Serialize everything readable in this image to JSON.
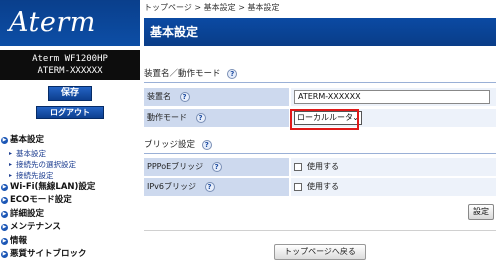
{
  "sidebar": {
    "logo": "Aterm",
    "model_line1": "Aterm WF1200HP",
    "model_line2": "ATERM-XXXXXX",
    "save_label": "保存",
    "logout_label": "ログアウト",
    "menu": [
      {
        "label": "基本設定",
        "bullet": "▶"
      },
      {
        "label": "基本設定",
        "sub": true
      },
      {
        "label": "接続先の選択設定",
        "sub": true
      },
      {
        "label": "接続先設定",
        "sub": true
      },
      {
        "label": "Wi-Fi(無線LAN)設定",
        "bullet": "▶"
      },
      {
        "label": "ECOモード設定",
        "bullet": "▶"
      },
      {
        "label": "詳細設定",
        "bullet": "▶"
      },
      {
        "label": "メンテナンス",
        "bullet": "▶"
      },
      {
        "label": "情報",
        "bullet": "▶"
      },
      {
        "label": "悪質サイトブロック",
        "bullet": "▶"
      }
    ]
  },
  "breadcrumb": {
    "top": "トップページ",
    "sep1": ">",
    "parent": "基本設定",
    "sep2": ">",
    "current": "基本設定"
  },
  "page_title": "基本設定",
  "sections": {
    "device": {
      "heading": "装置名／動作モード",
      "help": "?",
      "device_name_label": "装置名",
      "device_name_value": "ATERM-XXXXXX",
      "mode_label": "動作モード",
      "mode_value": "ローカルルータ"
    },
    "bridge": {
      "heading": "ブリッジ設定",
      "help": "?",
      "pppoe_label": "PPPoEブリッジ",
      "pppoe_check_label": "使用する",
      "ipv6_label": "IPv6ブリッジ",
      "ipv6_check_label": "使用する"
    }
  },
  "buttons": {
    "set": "設定",
    "back_to_top": "トップページへ戻る"
  },
  "colors": {
    "brand_blue": "#0b4aa3",
    "label_cell": "#cdd9ee",
    "value_cell": "#edf2fa",
    "highlight": "#e01818"
  }
}
